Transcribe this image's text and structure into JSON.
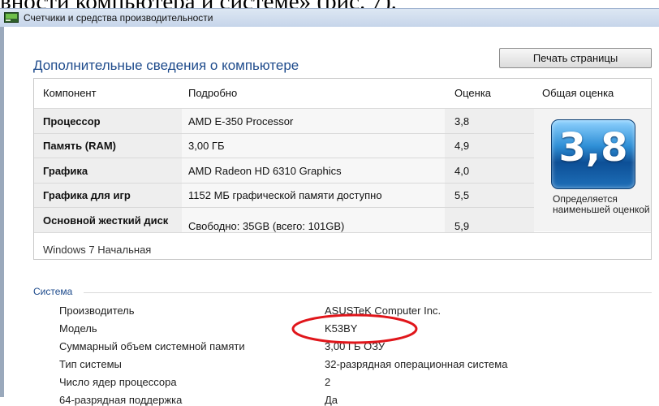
{
  "document_fragment": "вности компьютера и системе» (рис. 7).",
  "window": {
    "title": "Счетчики и средства производительности"
  },
  "page": {
    "heading": "Дополнительные сведения о компьютере",
    "print_button": "Печать страницы"
  },
  "table": {
    "headers": {
      "component": "Компонент",
      "detail": "Подробно",
      "score": "Оценка",
      "overall": "Общая оценка"
    },
    "rows": [
      {
        "name": "Процессор",
        "detail": "AMD E-350 Processor",
        "score": "3,8"
      },
      {
        "name": "Память (RAM)",
        "detail": "3,00 ГБ",
        "score": "4,9"
      },
      {
        "name": "Графика",
        "detail": "AMD Radeon HD 6310 Graphics",
        "score": "4,0"
      },
      {
        "name": "Графика для игр",
        "detail": "1152 МБ графической памяти доступно",
        "score": "5,5"
      },
      {
        "name": "Основной жесткий диск",
        "detail": "Свободно: 35GB (всего: 101GB)",
        "score": "5,9"
      }
    ],
    "overall_score": "3,8",
    "overall_note": "Определяется наименьшей оценкой",
    "os_edition": "Windows 7 Начальная"
  },
  "system": {
    "label": "Система",
    "items": [
      {
        "key": "Производитель",
        "value": "ASUSTeK Computer Inc."
      },
      {
        "key": "Модель",
        "value": "K53BY"
      },
      {
        "key": "Суммарный объем системной памяти",
        "value": "3,00 ГБ ОЗУ"
      },
      {
        "key": "Тип системы",
        "value": "32-разрядная операционная система"
      },
      {
        "key": "Число ядер процессора",
        "value": "2"
      },
      {
        "key": "64-разрядная поддержка",
        "value": "Да"
      }
    ]
  },
  "colors": {
    "heading": "#1e4b8c",
    "badge": "#2f8fd6",
    "annotation": "#e0161b"
  },
  "icons": {
    "window": "window-app-icon"
  }
}
